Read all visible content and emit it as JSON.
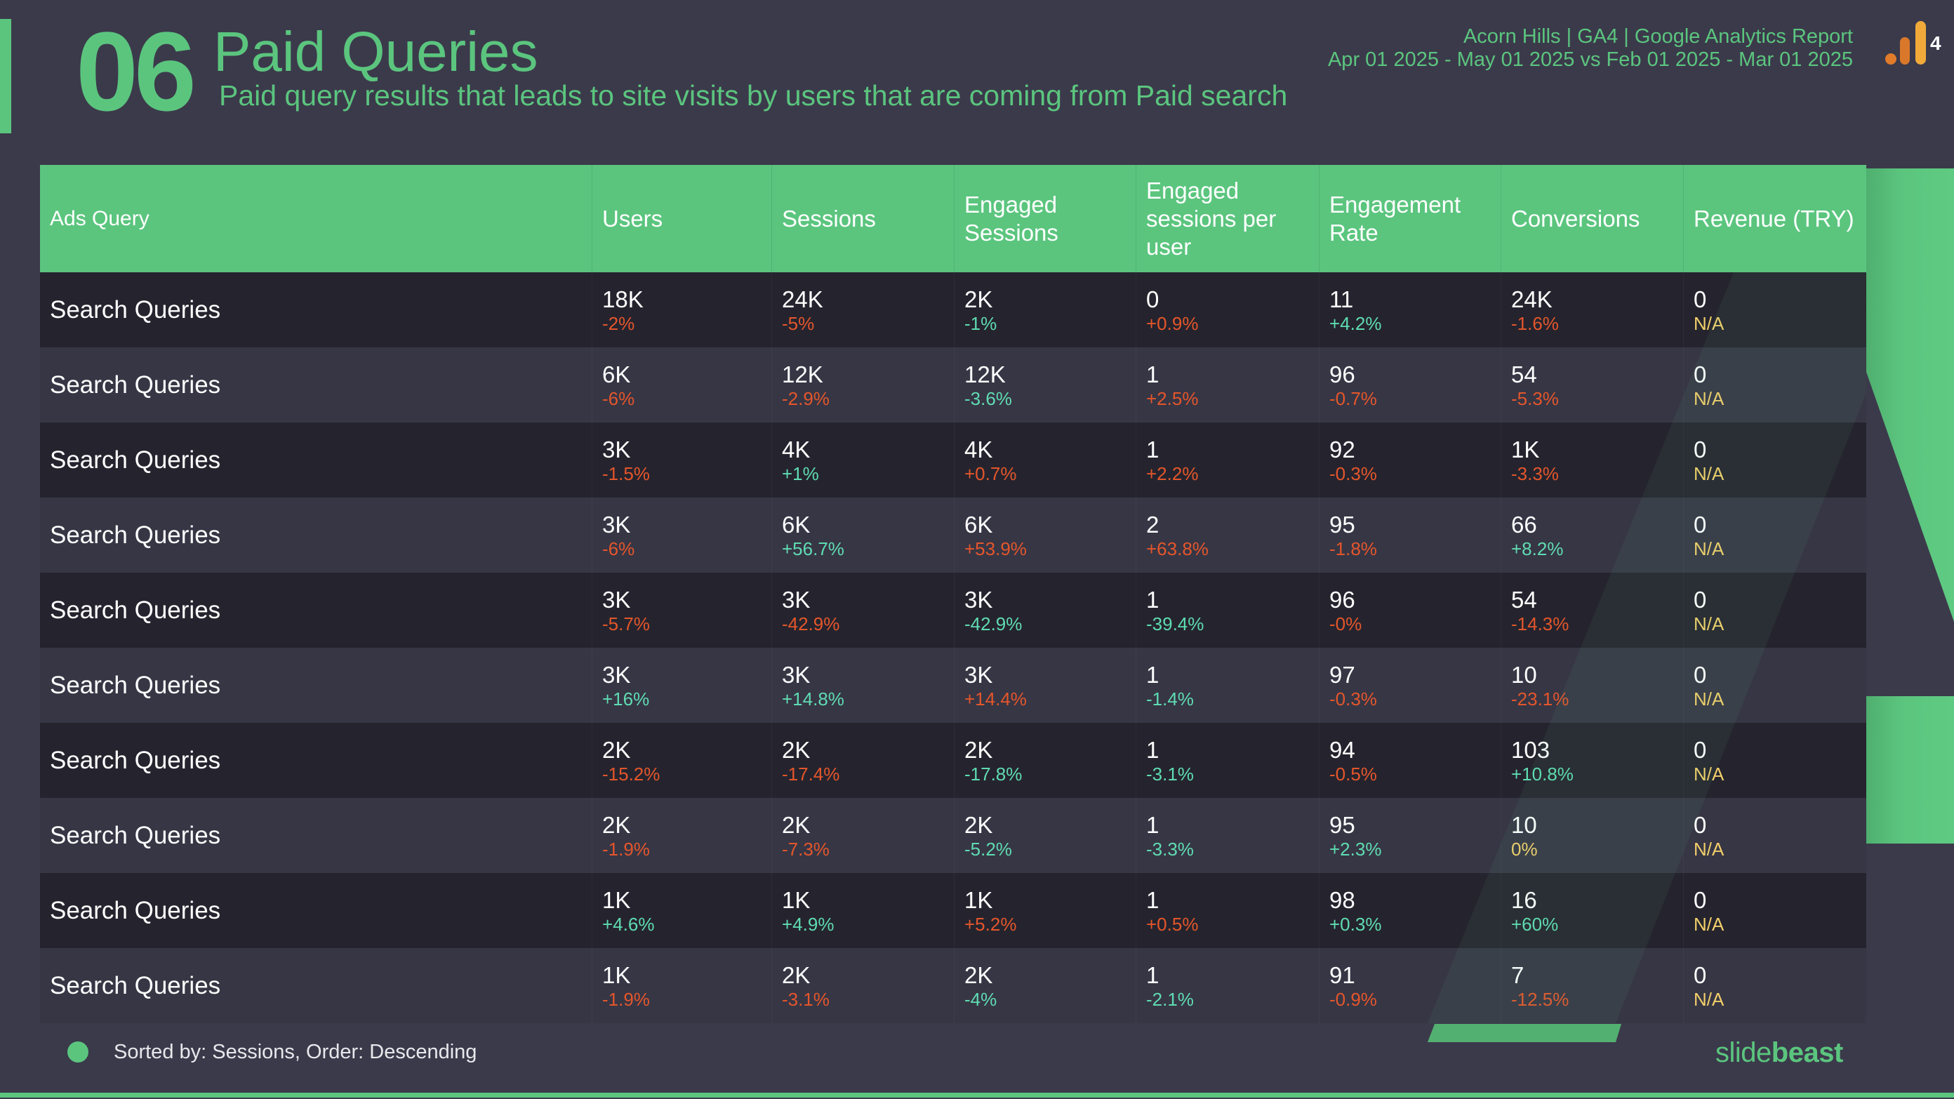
{
  "header": {
    "section_number": "06",
    "title": "Paid Queries",
    "subtitle": "Paid query results that leads to site visits by users that are coming from Paid search",
    "report_title": "Acorn Hills | GA4 | Google Analytics Report",
    "date_range": "Apr 01 2025 - May 01 2025 vs Feb 01 2025 - Mar 01 2025",
    "ga_badge": "4",
    "icon": "google-analytics-icon"
  },
  "colors": {
    "accent": "#5bc57e",
    "negative": "#e4562b",
    "positive": "#5fdcb2",
    "neutral": "#f2cf6a",
    "background": "#3b3a4b",
    "row_dark": "#25242e",
    "row_light": "#373645"
  },
  "table": {
    "columns": [
      "Ads Query",
      "Users",
      "Sessions",
      "Engaged Sessions",
      "Engaged sessions per user",
      "Engagement Rate",
      "Conversions",
      "Revenue (TRY)"
    ],
    "rows": [
      {
        "query": "Search Queries",
        "cells": [
          {
            "value": "18K",
            "delta": "-2%",
            "tone": "neg"
          },
          {
            "value": "24K",
            "delta": "-5%",
            "tone": "neg"
          },
          {
            "value": "2K",
            "delta": "-1%",
            "tone": "pos"
          },
          {
            "value": "0",
            "delta": "+0.9%",
            "tone": "neg"
          },
          {
            "value": "11",
            "delta": "+4.2%",
            "tone": "pos"
          },
          {
            "value": "24K",
            "delta": "-1.6%",
            "tone": "neg"
          },
          {
            "value": "0",
            "delta": "N/A",
            "tone": "neu"
          }
        ]
      },
      {
        "query": "Search Queries",
        "cells": [
          {
            "value": "6K",
            "delta": "-6%",
            "tone": "neg"
          },
          {
            "value": "12K",
            "delta": "-2.9%",
            "tone": "neg"
          },
          {
            "value": "12K",
            "delta": "-3.6%",
            "tone": "pos"
          },
          {
            "value": "1",
            "delta": "+2.5%",
            "tone": "neg"
          },
          {
            "value": "96",
            "delta": "-0.7%",
            "tone": "neg"
          },
          {
            "value": "54",
            "delta": "-5.3%",
            "tone": "neg"
          },
          {
            "value": "0",
            "delta": "N/A",
            "tone": "neu"
          }
        ]
      },
      {
        "query": "Search Queries",
        "cells": [
          {
            "value": "3K",
            "delta": "-1.5%",
            "tone": "neg"
          },
          {
            "value": "4K",
            "delta": "+1%",
            "tone": "pos"
          },
          {
            "value": "4K",
            "delta": "+0.7%",
            "tone": "neg"
          },
          {
            "value": "1",
            "delta": "+2.2%",
            "tone": "neg"
          },
          {
            "value": "92",
            "delta": "-0.3%",
            "tone": "neg"
          },
          {
            "value": "1K",
            "delta": "-3.3%",
            "tone": "neg"
          },
          {
            "value": "0",
            "delta": "N/A",
            "tone": "neu"
          }
        ]
      },
      {
        "query": "Search Queries",
        "cells": [
          {
            "value": "3K",
            "delta": "-6%",
            "tone": "neg"
          },
          {
            "value": "6K",
            "delta": "+56.7%",
            "tone": "pos"
          },
          {
            "value": "6K",
            "delta": "+53.9%",
            "tone": "neg"
          },
          {
            "value": "2",
            "delta": "+63.8%",
            "tone": "neg"
          },
          {
            "value": "95",
            "delta": "-1.8%",
            "tone": "neg"
          },
          {
            "value": "66",
            "delta": "+8.2%",
            "tone": "pos"
          },
          {
            "value": "0",
            "delta": "N/A",
            "tone": "neu"
          }
        ]
      },
      {
        "query": "Search Queries",
        "cells": [
          {
            "value": "3K",
            "delta": "-5.7%",
            "tone": "neg"
          },
          {
            "value": "3K",
            "delta": "-42.9%",
            "tone": "neg"
          },
          {
            "value": "3K",
            "delta": "-42.9%",
            "tone": "pos"
          },
          {
            "value": "1",
            "delta": "-39.4%",
            "tone": "pos"
          },
          {
            "value": "96",
            "delta": "-0%",
            "tone": "neg"
          },
          {
            "value": "54",
            "delta": "-14.3%",
            "tone": "neg"
          },
          {
            "value": "0",
            "delta": "N/A",
            "tone": "neu"
          }
        ]
      },
      {
        "query": "Search Queries",
        "cells": [
          {
            "value": "3K",
            "delta": "+16%",
            "tone": "pos"
          },
          {
            "value": "3K",
            "delta": "+14.8%",
            "tone": "pos"
          },
          {
            "value": "3K",
            "delta": "+14.4%",
            "tone": "neg"
          },
          {
            "value": "1",
            "delta": "-1.4%",
            "tone": "pos"
          },
          {
            "value": "97",
            "delta": "-0.3%",
            "tone": "neg"
          },
          {
            "value": "10",
            "delta": "-23.1%",
            "tone": "neg"
          },
          {
            "value": "0",
            "delta": "N/A",
            "tone": "neu"
          }
        ]
      },
      {
        "query": "Search Queries",
        "cells": [
          {
            "value": "2K",
            "delta": "-15.2%",
            "tone": "neg"
          },
          {
            "value": "2K",
            "delta": "-17.4%",
            "tone": "neg"
          },
          {
            "value": "2K",
            "delta": "-17.8%",
            "tone": "pos"
          },
          {
            "value": "1",
            "delta": "-3.1%",
            "tone": "pos"
          },
          {
            "value": "94",
            "delta": "-0.5%",
            "tone": "neg"
          },
          {
            "value": "103",
            "delta": "+10.8%",
            "tone": "pos"
          },
          {
            "value": "0",
            "delta": "N/A",
            "tone": "neu"
          }
        ]
      },
      {
        "query": "Search Queries",
        "cells": [
          {
            "value": "2K",
            "delta": "-1.9%",
            "tone": "neg"
          },
          {
            "value": "2K",
            "delta": "-7.3%",
            "tone": "neg"
          },
          {
            "value": "2K",
            "delta": "-5.2%",
            "tone": "pos"
          },
          {
            "value": "1",
            "delta": "-3.3%",
            "tone": "pos"
          },
          {
            "value": "95",
            "delta": "+2.3%",
            "tone": "pos"
          },
          {
            "value": "10",
            "delta": "0%",
            "tone": "neu"
          },
          {
            "value": "0",
            "delta": "N/A",
            "tone": "neu"
          }
        ]
      },
      {
        "query": "Search Queries",
        "cells": [
          {
            "value": "1K",
            "delta": "+4.6%",
            "tone": "pos"
          },
          {
            "value": "1K",
            "delta": "+4.9%",
            "tone": "pos"
          },
          {
            "value": "1K",
            "delta": "+5.2%",
            "tone": "neg"
          },
          {
            "value": "1",
            "delta": "+0.5%",
            "tone": "neg"
          },
          {
            "value": "98",
            "delta": "+0.3%",
            "tone": "pos"
          },
          {
            "value": "16",
            "delta": "+60%",
            "tone": "pos"
          },
          {
            "value": "0",
            "delta": "N/A",
            "tone": "neu"
          }
        ]
      },
      {
        "query": "Search Queries",
        "cells": [
          {
            "value": "1K",
            "delta": "-1.9%",
            "tone": "neg"
          },
          {
            "value": "2K",
            "delta": "-3.1%",
            "tone": "neg"
          },
          {
            "value": "2K",
            "delta": "-4%",
            "tone": "pos"
          },
          {
            "value": "1",
            "delta": "-2.1%",
            "tone": "pos"
          },
          {
            "value": "91",
            "delta": "-0.9%",
            "tone": "neg"
          },
          {
            "value": "7",
            "delta": "-12.5%",
            "tone": "neg"
          },
          {
            "value": "0",
            "delta": "N/A",
            "tone": "neu"
          }
        ]
      }
    ]
  },
  "footer": {
    "sort_note": "Sorted by: Sessions, Order: Descending",
    "logo_light": "slide",
    "logo_bold": "beast"
  }
}
